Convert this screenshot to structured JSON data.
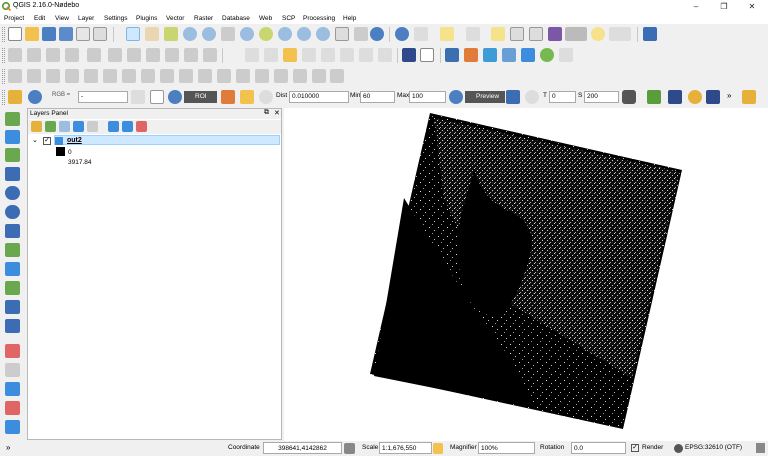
{
  "window": {
    "title": "QGIS 2.16.0-Nødebo",
    "minimize": "–",
    "maximize": "❐",
    "close": "✕"
  },
  "menu": [
    "Project",
    "Edit",
    "View",
    "Layer",
    "Settings",
    "Plugins",
    "Vector",
    "Raster",
    "Database",
    "Web",
    "SCP",
    "Processing",
    "Help"
  ],
  "scp_toolbar": {
    "band_set": "RGB =",
    "band_value": "-",
    "roi_label": "ROI",
    "dist_label": "Dist",
    "dist_value": "0.010000",
    "min_label": "Min",
    "min_value": "60",
    "max_label": "Max",
    "max_value": "100",
    "preview_label": "Preview",
    "t_label": "T",
    "t_value": "0",
    "s_label": "S",
    "s_value": "200",
    "more": "»"
  },
  "layers_panel": {
    "title": "Layers Panel",
    "layer_name": "out2",
    "legend_min": "0",
    "legend_max": "3917.84"
  },
  "statusbar": {
    "coordinate_label": "Coordinate",
    "coordinate_value": "398641,4142862",
    "scale_label": "Scale",
    "scale_value": "1:1,676,550",
    "magnifier_label": "Magnifier",
    "magnifier_value": "100%",
    "rotation_label": "Rotation",
    "rotation_value": "0.0",
    "render_label": "Render",
    "crs_label": "EPSG:32610 (OTF)"
  },
  "colors": {
    "selection": "#cde8ff",
    "raster": "#000000",
    "accent": "#3c8dde"
  }
}
